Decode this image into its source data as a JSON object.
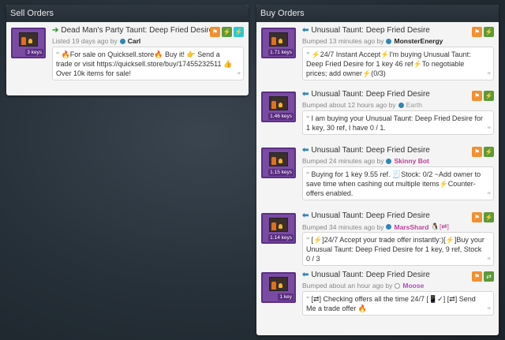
{
  "sell": {
    "header": "Sell Orders",
    "orders": [
      {
        "name": "Dead Man's Party Taunt: Deep Fried Desire",
        "listed": "Listed 19 days ago by",
        "user": "Carl",
        "user_color": "#222222",
        "dot_color": "#2f86b8",
        "price": "3 keys",
        "comment": "🔥For sale on Quicksell.store🔥 Buy it! 👉 Send a trade or visit https://quicksell.store/buy/17455232511 👍 Over 10k items for sale!"
      }
    ]
  },
  "buy": {
    "header": "Buy Orders",
    "orders": [
      {
        "name": "Unusual Taunt: Deep Fried Desire",
        "listed": "Bumped 13 minutes ago by",
        "user": "MonsterEnergy",
        "user_color": "#222222",
        "dot_color": "#2f86b8",
        "price": "1.71 keys",
        "comment": "⚡24/7 Instant Accept⚡I'm buying Unusual Taunt: Deep Fried Desire for 1 key 46 ref⚡To negotiable prices; add owner⚡(0/3)"
      },
      {
        "name": "Unusual Taunt: Deep Fried Desire",
        "listed": "Bumped about 12 hours ago by",
        "user": "Earth",
        "user_color": "#999999",
        "dot_color": "#2f86b8",
        "price": "1.46 keys",
        "comment": "I am buying your Unusual Taunt: Deep Fried Desire for 1 key, 30 ref, I have 0 / 1."
      },
      {
        "name": "Unusual Taunt: Deep Fried Desire",
        "listed": "Bumped 24 minutes ago by",
        "user": "Skinny Bot",
        "user_color": "#c2409a",
        "dot_color": "#2f86b8",
        "price": "1.15 keys",
        "comment": "Buying for 1 key 9.55 ref. 🧾Stock: 0/2 ~Add owner to save time when cashing out multiple items⚡Counter-offers enabled."
      },
      {
        "name": "Unusual Taunt: Deep Fried Desire",
        "listed": "Bumped 34 minutes ago by",
        "user": "MarsShard",
        "user_extra": "🐧[⇄]",
        "user_color": "#c2409a",
        "dot_color": "#2f86b8",
        "price": "1.14 keys",
        "comment": "[⚡]24/7 Accept your trade offer instantly:)[⚡]Buy your Unusual Taunt: Deep Fried Desire for 1 key, 9 ref, Stock 0 / 3"
      },
      {
        "name": "Unusual Taunt: Deep Fried Desire",
        "listed": "Bumped about an hour ago by",
        "user": "Moose",
        "user_color": "#b04cc4",
        "dot_color": "#ffffff",
        "price": "1 key",
        "comment": "[⇄] Checking offers all the time 24/7 [📱✓] [⇄] Send Me a trade offer 🔥"
      }
    ]
  },
  "icons": {
    "flag": "⚑",
    "lightning": "⚡",
    "swap": "⇄",
    "tag": "🏷",
    "quote_open": "“",
    "quote_close": "”",
    "sell_arrow": "➔",
    "buy_arrow": "⬅"
  }
}
